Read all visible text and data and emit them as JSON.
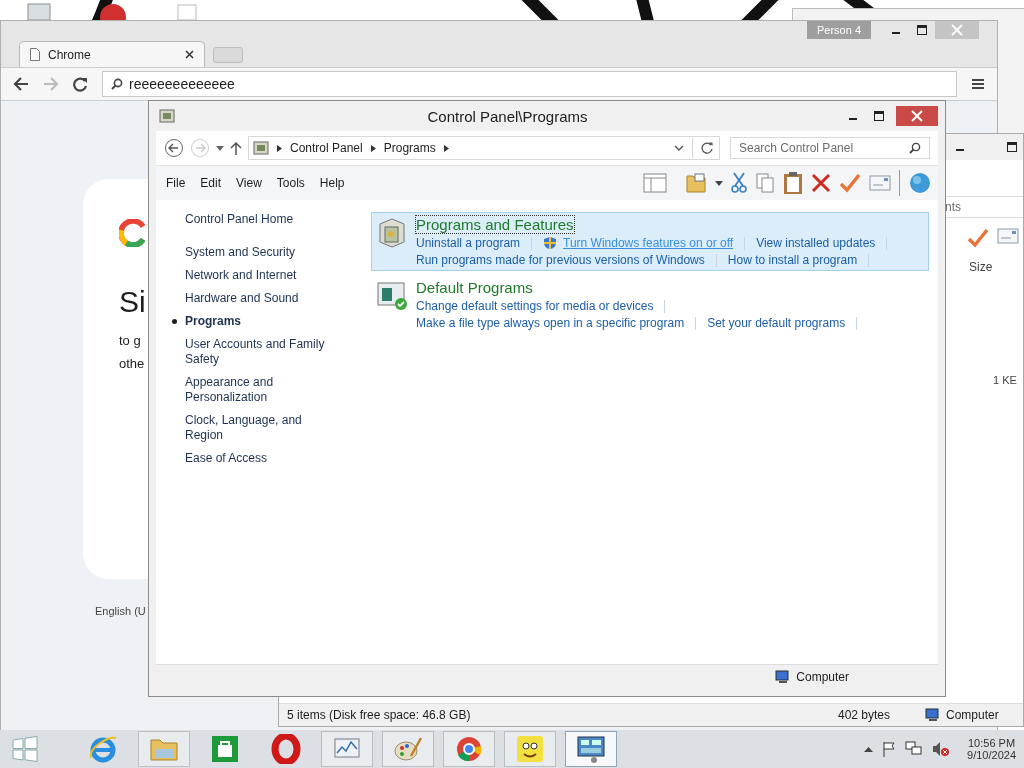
{
  "chrome": {
    "tab": {
      "title": "Chrome"
    },
    "profile": "Person 4",
    "omnibox": {
      "value": "reeeeeeeeeeeee"
    },
    "page": {
      "heading": "Si",
      "lines": [
        "to g",
        "othe"
      ],
      "footer": "English (U"
    }
  },
  "explorer": {
    "search": {
      "placeholder": "nts"
    },
    "column": "Size",
    "cell": "1 KE",
    "status": {
      "items": "5 items (Disk free space: 46.8 GB)",
      "size": "402 bytes",
      "location": "Computer"
    }
  },
  "control_panel": {
    "title": "Control Panel\\Programs",
    "breadcrumb": [
      "Control Panel",
      "Programs"
    ],
    "search": {
      "placeholder": "Search Control Panel"
    },
    "menu": [
      "File",
      "Edit",
      "View",
      "Tools",
      "Help"
    ],
    "nav": [
      {
        "label": "Control Panel Home",
        "kind": "home",
        "selected": false
      },
      {
        "label": "System and Security",
        "kind": "category",
        "selected": false
      },
      {
        "label": "Network and Internet",
        "kind": "category",
        "selected": false
      },
      {
        "label": "Hardware and Sound",
        "kind": "category",
        "selected": false
      },
      {
        "label": "Programs",
        "kind": "category",
        "selected": true
      },
      {
        "label": "User Accounts and Family Safety",
        "kind": "category",
        "selected": false
      },
      {
        "label": "Appearance and Personalization",
        "kind": "category",
        "selected": false
      },
      {
        "label": "Clock, Language, and Region",
        "kind": "category",
        "selected": false
      },
      {
        "label": "Ease of Access",
        "kind": "category",
        "selected": false
      }
    ],
    "categories": [
      {
        "title": "Programs and Features",
        "kind": "programs",
        "highlighted": true,
        "link_lines": [
          {
            "links": [
              {
                "label": "Uninstall a program",
                "shield": false,
                "hover": false
              },
              {
                "label": "Turn Windows features on or off",
                "shield": true,
                "hover": true
              },
              {
                "label": "View installed updates",
                "shield": false,
                "hover": false
              }
            ]
          },
          {
            "links": [
              {
                "label": "Run programs made for previous versions of Windows",
                "shield": false,
                "hover": false
              },
              {
                "label": "How to install a program",
                "shield": false,
                "hover": false
              }
            ]
          }
        ]
      },
      {
        "title": "Default Programs",
        "kind": "defaults",
        "highlighted": false,
        "link_lines": [
          {
            "links": [
              {
                "label": "Change default settings for media or devices",
                "shield": false,
                "hover": false
              }
            ]
          },
          {
            "links": [
              {
                "label": "Make a file type always open in a specific program",
                "shield": false,
                "hover": false
              },
              {
                "label": "Set your default programs",
                "shield": false,
                "hover": false
              }
            ]
          }
        ]
      }
    ],
    "status": "Computer"
  },
  "taskbar": {
    "apps": [
      {
        "kind": "ie",
        "running": false,
        "active": false
      },
      {
        "kind": "explorer",
        "running": true,
        "active": false
      },
      {
        "kind": "store",
        "running": false,
        "active": false
      },
      {
        "kind": "opera",
        "running": false,
        "active": false
      },
      {
        "kind": "monitor",
        "running": true,
        "active": false
      },
      {
        "kind": "paint",
        "running": true,
        "active": false
      },
      {
        "kind": "chrome",
        "running": true,
        "active": false
      },
      {
        "kind": "tile",
        "running": true,
        "active": false
      },
      {
        "kind": "controlpanel",
        "running": true,
        "active": true
      }
    ],
    "clock": {
      "time": "10:56 PM",
      "date": "9/10/2024"
    }
  }
}
